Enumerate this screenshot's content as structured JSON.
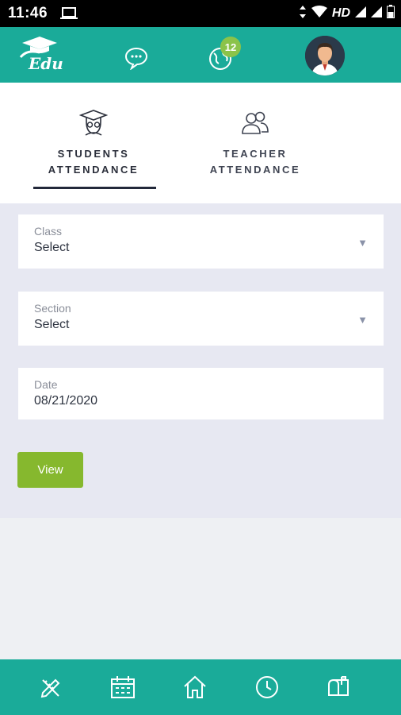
{
  "status_bar": {
    "time": "11:46",
    "network_label": "HD"
  },
  "header": {
    "logo_text": "Edu",
    "notification_count": "12",
    "colors": {
      "bar": "#1aab99",
      "badge": "#8bc34a"
    }
  },
  "tabs": [
    {
      "label": "STUDENTS\nATTENDANCE",
      "icon": "student-graduate-icon",
      "active": true
    },
    {
      "label": "TEACHER\nATTENDANCE",
      "icon": "teachers-group-icon",
      "active": false
    }
  ],
  "form": {
    "class": {
      "label": "Class",
      "value": "Select"
    },
    "section": {
      "label": "Section",
      "value": "Select"
    },
    "date": {
      "label": "Date",
      "value": "08/21/2020"
    },
    "view_button": "View",
    "colors": {
      "button": "#86b82e"
    }
  },
  "bottom_nav": [
    {
      "icon": "pencil-ruler-icon"
    },
    {
      "icon": "calendar-icon"
    },
    {
      "icon": "home-icon"
    },
    {
      "icon": "clock-icon"
    },
    {
      "icon": "mailbox-icon"
    }
  ]
}
